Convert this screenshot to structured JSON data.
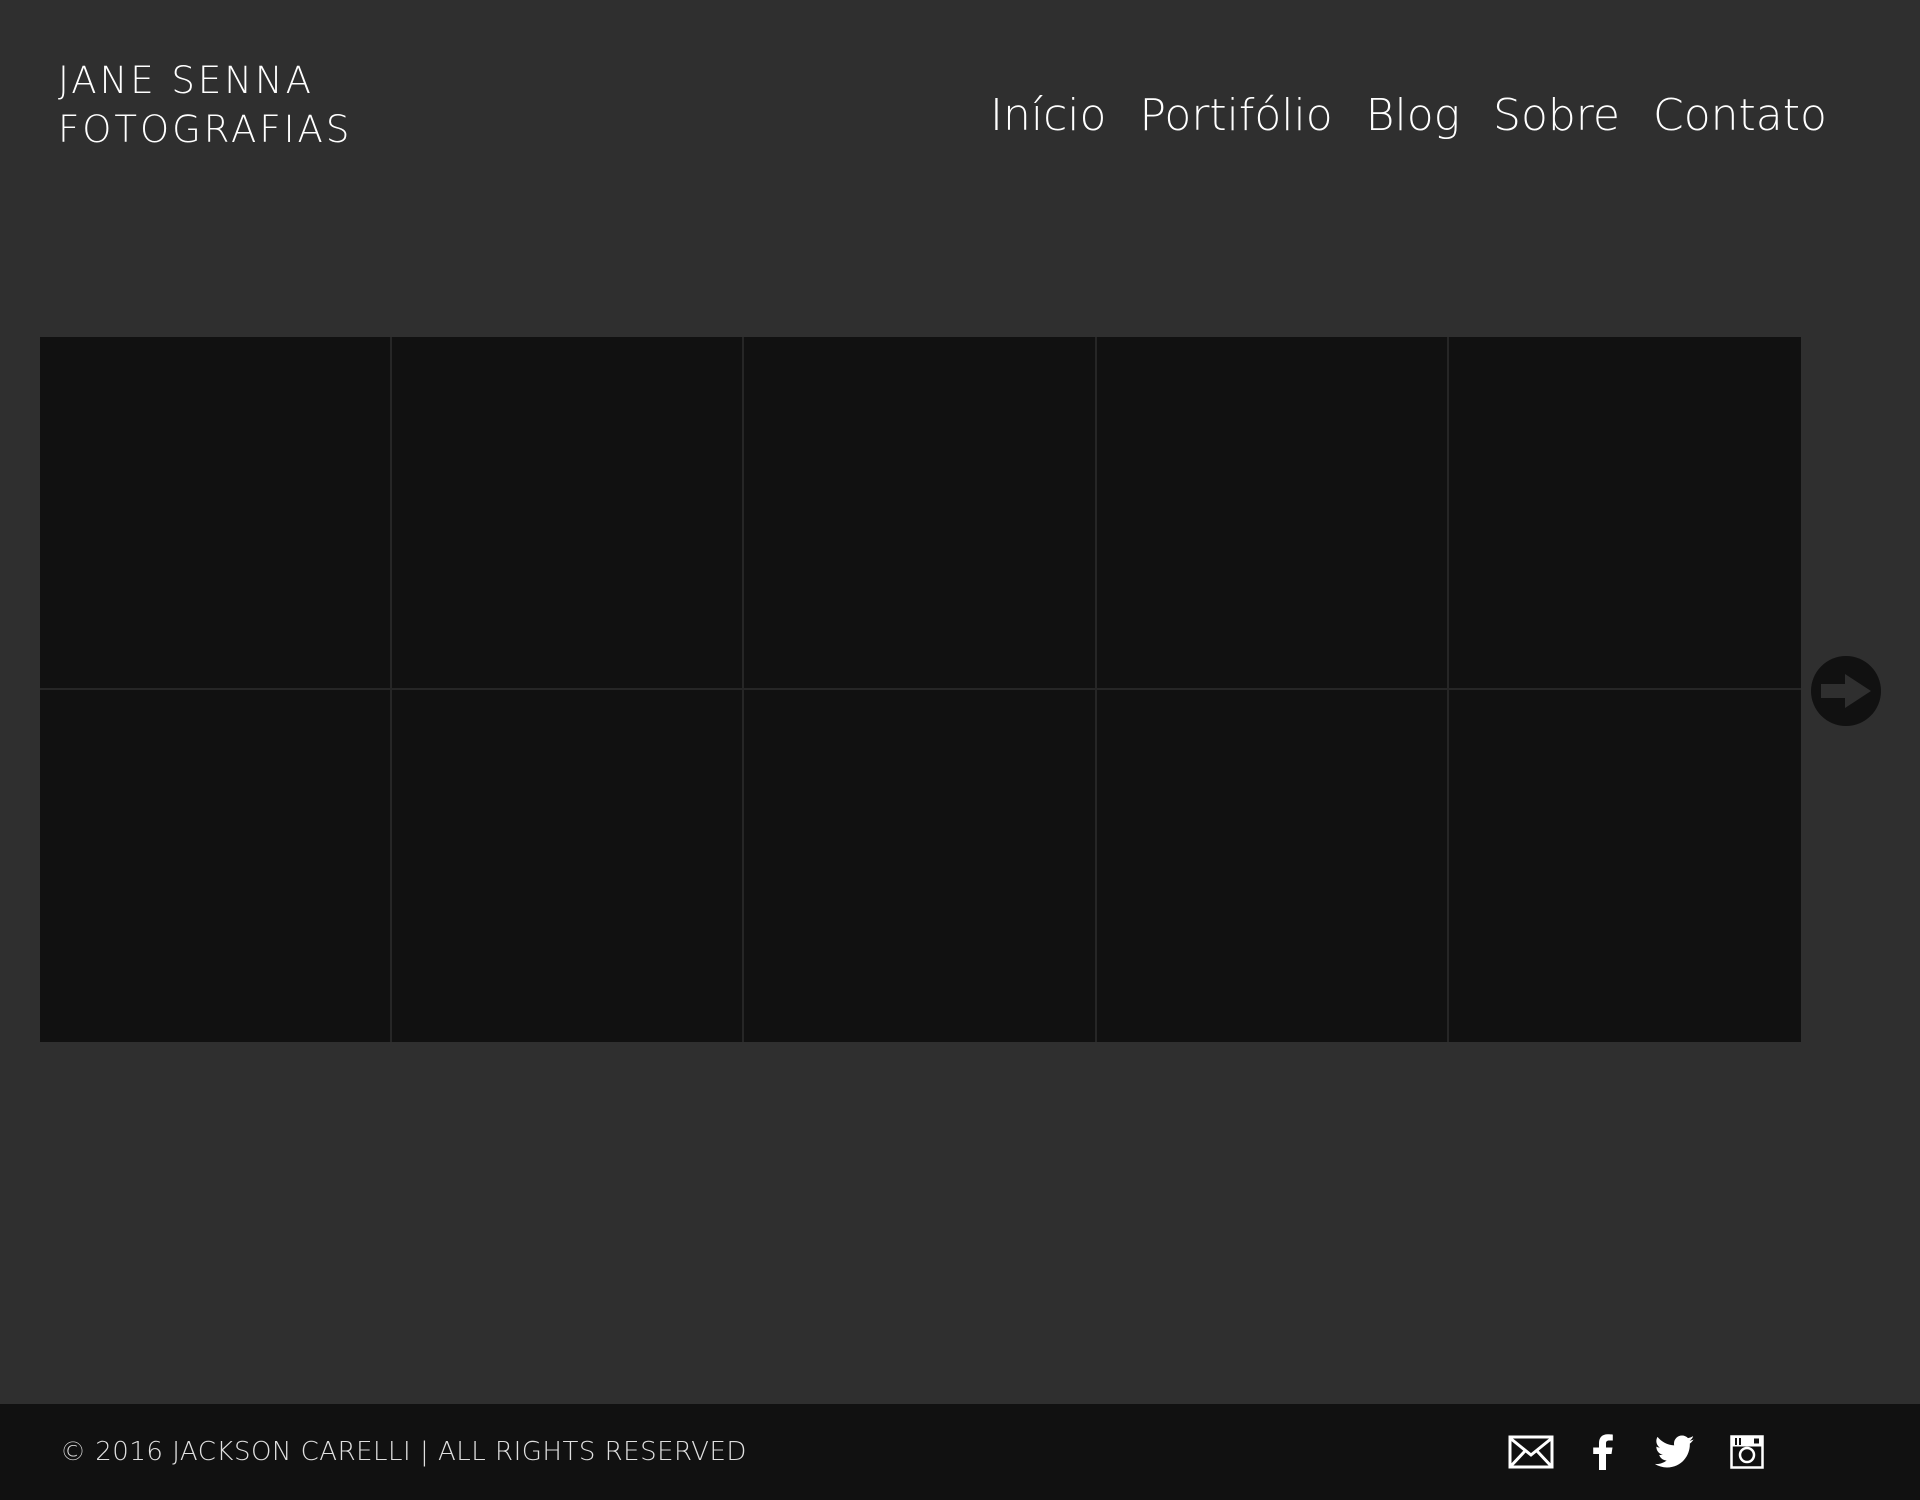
{
  "header": {
    "logo_line1": "JANE SENNA",
    "logo_line2": "FOTOGRAFIAS"
  },
  "nav": {
    "items": [
      {
        "label": "Início"
      },
      {
        "label": "Portifólio"
      },
      {
        "label": "Blog"
      },
      {
        "label": "Sobre"
      },
      {
        "label": "Contato"
      }
    ]
  },
  "gallery": {
    "rows": 2,
    "columns": 5,
    "next_icon": "arrow-right-circle-icon"
  },
  "footer": {
    "copyright": "© 2016 JACKSON CARELLI | ALL RIGHTS RESERVED",
    "social_icons": [
      "email-icon",
      "facebook-icon",
      "twitter-icon",
      "instagram-icon"
    ]
  },
  "colors": {
    "background": "#2f2f2f",
    "gallery_tile": "#111111",
    "footer": "#111111",
    "text": "#ffffff"
  }
}
